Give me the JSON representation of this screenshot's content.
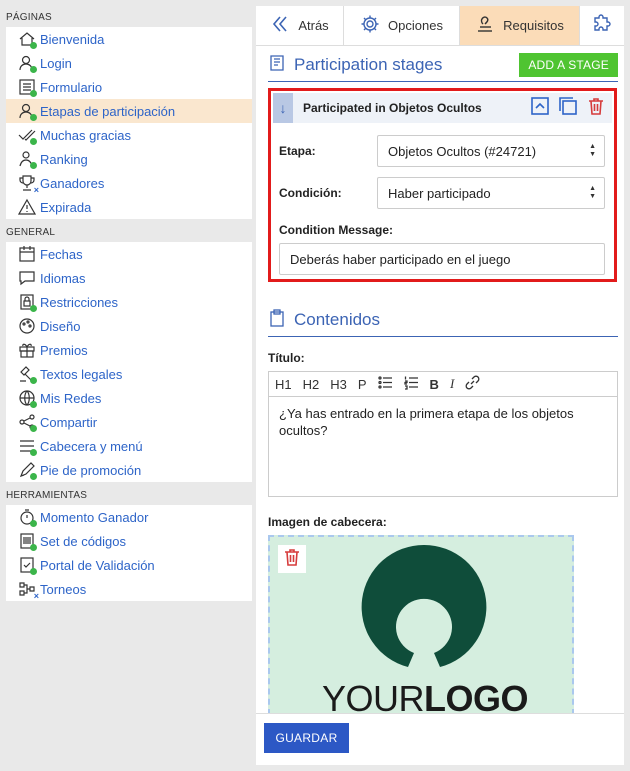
{
  "sidebar": {
    "sections": [
      {
        "title": "PÁGINAS",
        "items": [
          {
            "label": "Bienvenida",
            "icon": "home-icon",
            "badge": "dot"
          },
          {
            "label": "Login",
            "icon": "user-lock-icon",
            "badge": "dot"
          },
          {
            "label": "Formulario",
            "icon": "form-list-icon",
            "badge": "dot"
          },
          {
            "label": "Etapas de participación",
            "icon": "user-stages-icon",
            "badge": "dot",
            "active": true
          },
          {
            "label": "Muchas gracias",
            "icon": "double-check-icon",
            "badge": "dot"
          },
          {
            "label": "Ranking",
            "icon": "ranking-icon",
            "badge": "dot"
          },
          {
            "label": "Ganadores",
            "icon": "trophy-icon",
            "badge": "x"
          },
          {
            "label": "Expirada",
            "icon": "warning-icon",
            "badge": ""
          }
        ]
      },
      {
        "title": "GENERAL",
        "items": [
          {
            "label": "Fechas",
            "icon": "calendar-icon",
            "badge": ""
          },
          {
            "label": "Idiomas",
            "icon": "speech-bubble-icon",
            "badge": ""
          },
          {
            "label": "Restricciones",
            "icon": "restrictions-icon",
            "badge": "dot"
          },
          {
            "label": "Diseño",
            "icon": "palette-icon",
            "badge": ""
          },
          {
            "label": "Premios",
            "icon": "gift-icon",
            "badge": ""
          },
          {
            "label": "Textos legales",
            "icon": "gavel-icon",
            "badge": "dot"
          },
          {
            "label": "Mis Redes",
            "icon": "globe-icon",
            "badge": "dot"
          },
          {
            "label": "Compartir",
            "icon": "share-icon",
            "badge": "dot"
          },
          {
            "label": "Cabecera y menú",
            "icon": "menu-icon",
            "badge": "dot"
          },
          {
            "label": "Pie de promoción",
            "icon": "pen-icon",
            "badge": "dot"
          }
        ]
      },
      {
        "title": "HERRAMIENTAS",
        "items": [
          {
            "label": "Momento Ganador",
            "icon": "stopwatch-icon",
            "badge": "dot"
          },
          {
            "label": "Set de códigos",
            "icon": "codes-icon",
            "badge": "dot"
          },
          {
            "label": "Portal de Validación",
            "icon": "validation-icon",
            "badge": "dot"
          },
          {
            "label": "Torneos",
            "icon": "tournament-icon",
            "badge": "x"
          }
        ]
      }
    ]
  },
  "tabs": {
    "back": "Atrás",
    "options": "Opciones",
    "requirements": "Requisitos"
  },
  "stages": {
    "heading": "Participation stages",
    "add_button": "ADD A STAGE",
    "stage_title": "Participated in Objetos Ocultos",
    "etapa_label": "Etapa:",
    "etapa_value": "Objetos Ocultos (#24721)",
    "condicion_label": "Condición:",
    "condicion_value": "Haber participado",
    "message_label": "Condition Message:",
    "message_value": "Deberás haber participado en el juego"
  },
  "contents": {
    "heading": "Contenidos",
    "title_label": "Título:",
    "toolbar": [
      "H1",
      "H2",
      "H3",
      "P"
    ],
    "editor_text": "¿Ya has entrado en la primera etapa de los objetos ocultos?",
    "image_label": "Imagen de cabecera:",
    "logo_text_light": "YOUR",
    "logo_text_bold": "LOGO"
  },
  "footer": {
    "save": "GUARDAR"
  },
  "colors": {
    "link": "#2d64c8",
    "active_bg": "#fae7cf",
    "add_green": "#4fc431",
    "highlight_red": "#e21b1b",
    "save_blue": "#2c58c5",
    "badge_green": "#3bb54a",
    "logo_green": "#0f4d3a"
  }
}
